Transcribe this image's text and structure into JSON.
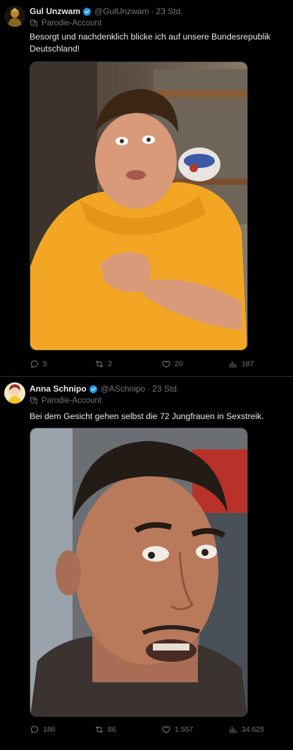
{
  "tweets": [
    {
      "author_name": "Gul Unzwam",
      "handle": "@GulUnzwam",
      "separator": "·",
      "time": "23 Std.",
      "badge_label": "Parodie-Account",
      "text": "Besorgt und nachdenklich blicke ich auf unsere Bundesrepublik Deutschland!",
      "replies": "5",
      "retweets": "2",
      "likes": "20",
      "views": "187",
      "avatar_icon": "golden-figure-avatar",
      "media_description": "photo"
    },
    {
      "author_name": "Anna Schnipo",
      "handle": "@ASchnipo",
      "separator": "·",
      "time": "23 Std.",
      "badge_label": "Parodie-Account",
      "text": "Bei dem Gesicht gehen selbst die 72 Jungfrauen in Sexstreik.",
      "replies": "186",
      "retweets": "86",
      "likes": "1.557",
      "views": "34.625",
      "avatar_icon": "cartoon-avatar",
      "media_description": "photo"
    }
  ],
  "colors": {
    "background": "#000000",
    "text": "#e7e9ea",
    "secondary": "#71767b",
    "verified": "#1d9bf0",
    "divider": "#2f3336"
  }
}
